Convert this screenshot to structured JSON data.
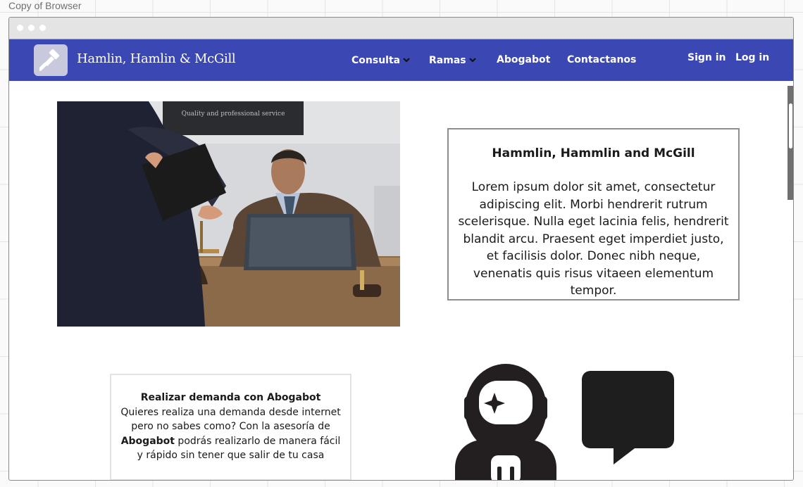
{
  "canvas": {
    "caption": "Copy of Browser"
  },
  "navbar": {
    "brand": "Hamlin, Hamlin & McGill",
    "logo_icon": "gavel-icon",
    "items": [
      {
        "label": "Consulta",
        "has_dropdown": true
      },
      {
        "label": "Ramas",
        "has_dropdown": true
      },
      {
        "label": "Abogabot",
        "has_dropdown": false
      },
      {
        "label": "Contactanos",
        "has_dropdown": false
      }
    ],
    "auth": {
      "sign_in": "Sign in",
      "log_in": "Log in"
    },
    "color": "#3b48b3"
  },
  "hero": {
    "photo": "lawyer-meeting-photo",
    "card_title": "Hammlin, Hammlin and McGill",
    "card_body": "Lorem ipsum dolor sit amet, consectetur adipiscing elit. Morbi hendrerit rutrum scelerisque. Nulla eget lacinia felis, hendrerit blandit arcu. Praesent eget imperdiet justo, et facilisis dolor. Donec nibh neque, venenatis quis risus vitaeen elementum tempor."
  },
  "cta": {
    "title": "Realizar demanda con Abogabot",
    "text_before": "Quieres realiza una demanda desde internet pero no sabes como? Con la asesoría de ",
    "text_bold": "Abogabot",
    "text_after": " podrás realizarlo de manera fácil y rápido sin tener que salir de tu casa"
  },
  "icons": {
    "robot": "astronaut-robot-icon",
    "chat": "chat-bubble-icon"
  }
}
